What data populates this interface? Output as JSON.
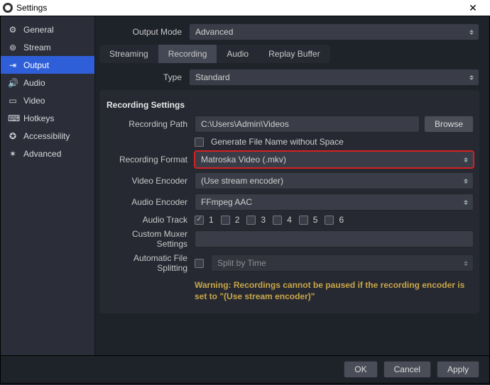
{
  "window": {
    "title": "Settings"
  },
  "sidebar": {
    "items": [
      {
        "label": "General",
        "icon": "⚙"
      },
      {
        "label": "Stream",
        "icon": "⊚"
      },
      {
        "label": "Output",
        "icon": "⇥"
      },
      {
        "label": "Audio",
        "icon": "🔊"
      },
      {
        "label": "Video",
        "icon": "▭"
      },
      {
        "label": "Hotkeys",
        "icon": "⌨"
      },
      {
        "label": "Accessibility",
        "icon": "✪"
      },
      {
        "label": "Advanced",
        "icon": "✶"
      }
    ]
  },
  "output_mode": {
    "label": "Output Mode",
    "value": "Advanced"
  },
  "subtabs": {
    "items": [
      "Streaming",
      "Recording",
      "Audio",
      "Replay Buffer"
    ],
    "active": "Recording"
  },
  "type_row": {
    "label": "Type",
    "value": "Standard"
  },
  "section_title": "Recording Settings",
  "rec_path": {
    "label": "Recording Path",
    "value": "C:\\Users\\Admin\\Videos",
    "browse": "Browse"
  },
  "gen_no_space": {
    "label": "Generate File Name without Space",
    "checked": false
  },
  "rec_format": {
    "label": "Recording Format",
    "value": "Matroska Video (.mkv)"
  },
  "video_encoder": {
    "label": "Video Encoder",
    "value": "(Use stream encoder)"
  },
  "audio_encoder": {
    "label": "Audio Encoder",
    "value": "FFmpeg AAC"
  },
  "audio_track": {
    "label": "Audio Track",
    "tracks": [
      {
        "n": "1",
        "checked": true
      },
      {
        "n": "2",
        "checked": false
      },
      {
        "n": "3",
        "checked": false
      },
      {
        "n": "4",
        "checked": false
      },
      {
        "n": "5",
        "checked": false
      },
      {
        "n": "6",
        "checked": false
      }
    ]
  },
  "muxer": {
    "label": "Custom Muxer Settings",
    "value": ""
  },
  "split": {
    "label": "Automatic File Splitting",
    "checked": false,
    "value": "Split by Time"
  },
  "warning_text": "Warning: Recordings cannot be paused if the recording encoder is set to \"(Use stream encoder)\"",
  "footer": {
    "ok": "OK",
    "cancel": "Cancel",
    "apply": "Apply"
  }
}
